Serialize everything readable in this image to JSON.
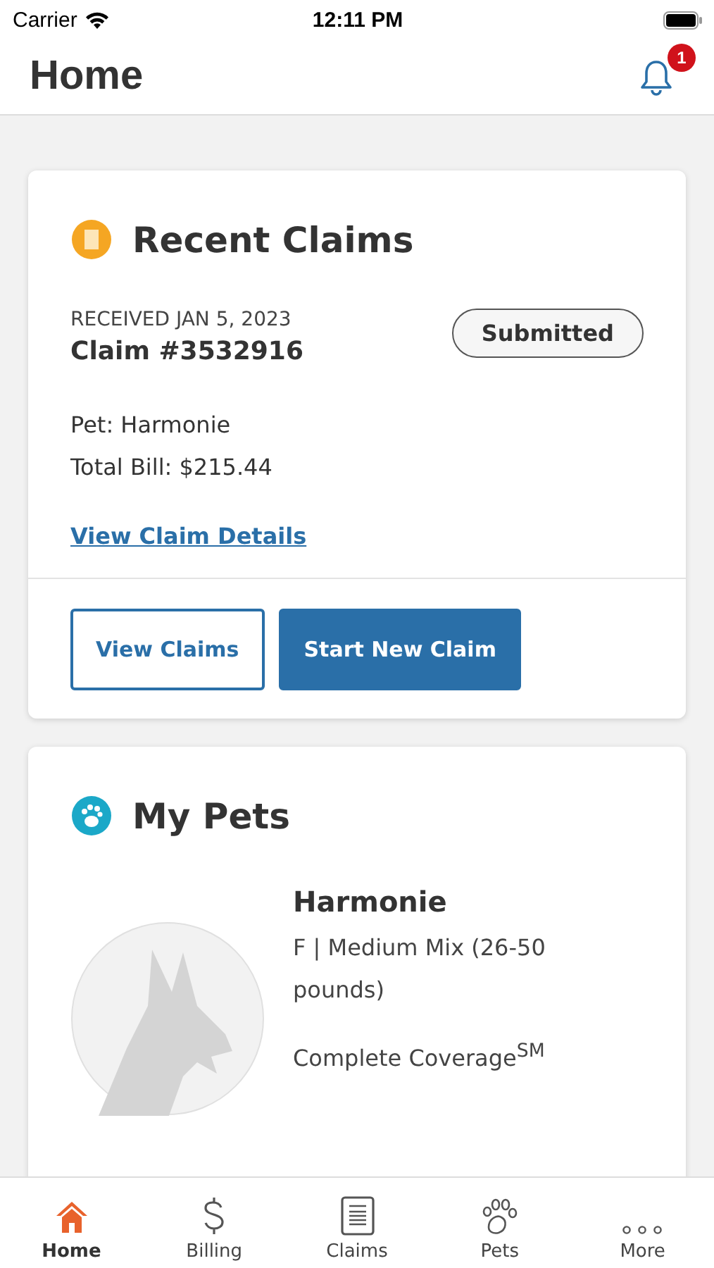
{
  "status_bar": {
    "carrier": "Carrier",
    "time": "12:11 PM"
  },
  "header": {
    "title": "Home",
    "notification_count": "1"
  },
  "recent_claims": {
    "title": "Recent Claims",
    "received": "RECEIVED JAN 5, 2023",
    "claim_number": "Claim #3532916",
    "status": "Submitted",
    "pet": "Pet: Harmonie",
    "total_bill": "Total Bill: $215.44",
    "details_link": "View Claim Details",
    "buttons": [
      {
        "label": "View Claims",
        "kind": "outline"
      },
      {
        "label": "Start New Claim",
        "kind": "filled"
      }
    ]
  },
  "my_pets": {
    "title": "My Pets",
    "pets": [
      {
        "name": "Harmonie",
        "breed": "F | Medium Mix (26-50 pounds)",
        "plan": "Complete Coverage$^{SM}$"
      }
    ]
  },
  "tab_bar": [
    {
      "label": "Home",
      "kind": "home",
      "selected": true
    },
    {
      "label": "Billing",
      "kind": "billing",
      "selected": false
    },
    {
      "label": "Claims",
      "kind": "claims",
      "selected": false
    },
    {
      "label": "Pets",
      "kind": "pets",
      "selected": false
    },
    {
      "label": "More",
      "kind": "more",
      "selected": false
    }
  ]
}
